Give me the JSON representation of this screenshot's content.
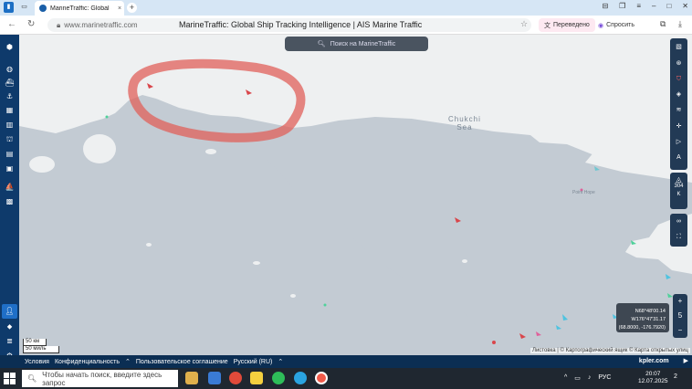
{
  "browser": {
    "tab_title": "MarineTraffic: Global Sh",
    "tab_close": "×",
    "new_tab": "+",
    "url": "www.marinetraffic.com",
    "page_title": "MarineTraffic: Global Ship Tracking Intelligence | AIS Marine Traffic",
    "translated_label": "Переведено",
    "ask_label": "Спросить"
  },
  "map": {
    "search_placeholder": "Поиск на MarineTraffic",
    "sea_label_1": "Chukchi",
    "sea_label_2": "Sea",
    "place_label": "Point Hope",
    "coords_lat": "N68°48'00.14",
    "coords_lon": "W176°47'31.17",
    "coords_xy": "(68.8000, -176.7920)",
    "zoom_in": "+",
    "zoom_level": "5",
    "zoom_out": "−",
    "rt_value": "304",
    "rt_unit": "K",
    "scale_km": "50 км",
    "scale_mi": "50 миль",
    "attribution": "Листовка | © Картографический ящик © Карта открытых улиц"
  },
  "footer": {
    "terms": "Условия",
    "privacy": "Конфиденциальность",
    "user_agreement": "Пользовательское соглашение",
    "language": "Русский (RU)",
    "brand": "kpler.com"
  },
  "taskbar": {
    "search_placeholder": "Чтобы начать поиск, введите здесь запрос",
    "lang": "РУС",
    "time": "20:07",
    "date": "12.07.2025",
    "notif_count": "2"
  },
  "colors": {
    "sidebar": "#0e3a6b",
    "map_sea": "#c3cbd3",
    "map_land": "#eef0f1",
    "highlight": "#e0605a"
  }
}
